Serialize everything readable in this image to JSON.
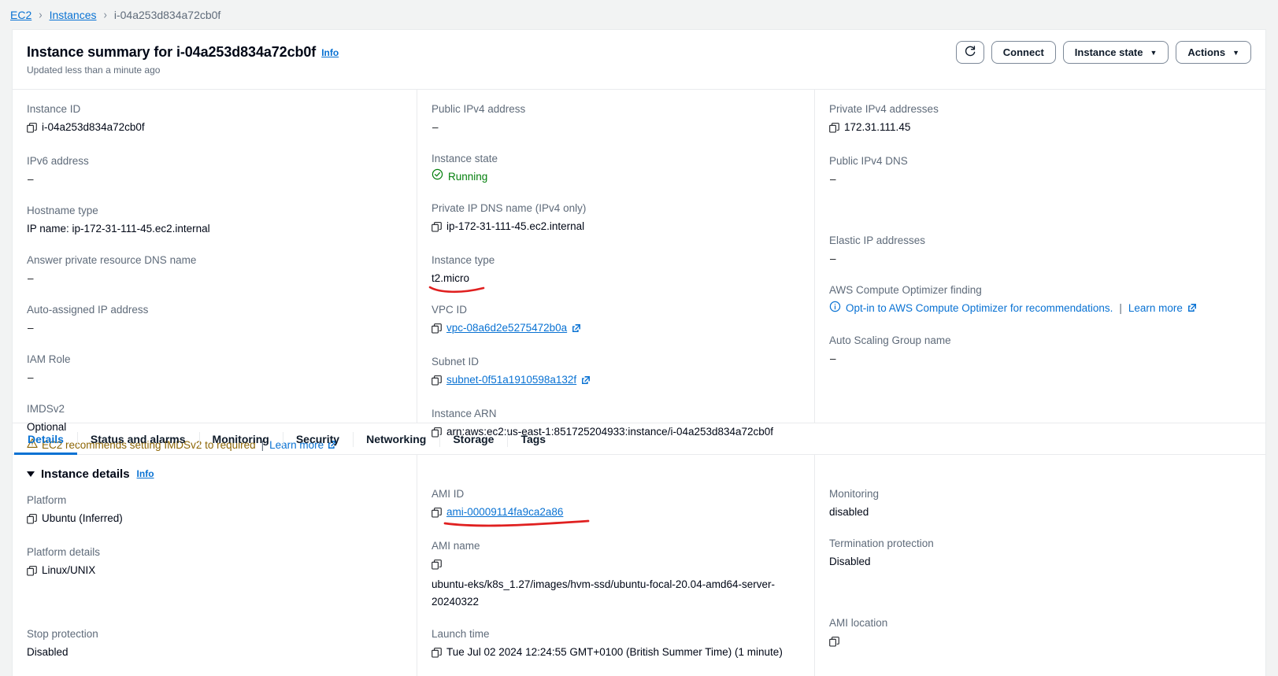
{
  "breadcrumb": {
    "items": [
      {
        "label": "EC2",
        "link": true
      },
      {
        "label": "Instances",
        "link": true
      },
      {
        "label": "i-04a253d834a72cb0f",
        "link": false
      }
    ],
    "separator": "›"
  },
  "header": {
    "title": "Instance summary for i-04a253d834a72cb0f",
    "info_label": "Info",
    "updated_text": "Updated less than a minute ago",
    "buttons": {
      "refresh_icon": "refresh-icon",
      "connect": "Connect",
      "instance_state": "Instance state",
      "actions": "Actions",
      "caret": "▼"
    }
  },
  "summary": {
    "col1": [
      {
        "label": "Instance ID",
        "value": "i-04a253d834a72cb0f",
        "copy": true
      },
      {
        "label": "IPv6 address",
        "value": "–",
        "copy": false
      },
      {
        "label": "Hostname type",
        "value": "IP name: ip-172-31-111-45.ec2.internal",
        "copy": false
      },
      {
        "label": "Answer private resource DNS name",
        "value": "–",
        "copy": false
      },
      {
        "label": "Auto-assigned IP address",
        "value": "–",
        "copy": false
      },
      {
        "label": "IAM Role",
        "value": "–",
        "copy": false
      },
      {
        "label": "IMDSv2",
        "value": "Optional",
        "copy": false
      }
    ],
    "imds_warning": {
      "icon": "warning-triangle-icon",
      "text": "EC2 recommends setting IMDSv2 to required",
      "separator": "|",
      "link": "Learn more"
    },
    "col2": [
      {
        "label": "Public IPv4 address",
        "value": "–",
        "copy": false
      },
      {
        "label": "Instance state",
        "value": "Running",
        "copy": false,
        "status": true
      },
      {
        "label": "Private IP DNS name (IPv4 only)",
        "value": "ip-172-31-111-45.ec2.internal",
        "copy": true
      },
      {
        "label": "Instance type",
        "value": "t2.micro",
        "copy": false,
        "annotated": true
      },
      {
        "label": "VPC ID",
        "value": "vpc-08a6d2e5275472b0a",
        "copy": true,
        "link": true,
        "external": true
      },
      {
        "label": "Subnet ID",
        "value": "subnet-0f51a1910598a132f",
        "copy": true,
        "link": true,
        "external": true
      },
      {
        "label": "Instance ARN",
        "value": "arn:aws:ec2:us-east-1:851725204933:instance/i-04a253d834a72cb0f",
        "copy": true
      }
    ],
    "col3": [
      {
        "label": "Private IPv4 addresses",
        "value": "172.31.111.45",
        "copy": true
      },
      {
        "label": "Public IPv4 DNS",
        "value": "–",
        "copy": false
      },
      {
        "label": "Elastic IP addresses",
        "value": "–",
        "copy": false
      }
    ],
    "optimizer": {
      "label": "AWS Compute Optimizer finding",
      "icon": "info-circle-icon",
      "link_text": "Opt-in to AWS Compute Optimizer for recommendations.",
      "separator": "|",
      "learn_more": "Learn more"
    },
    "asg": {
      "label": "Auto Scaling Group name",
      "value": "–"
    }
  },
  "tabs": [
    {
      "label": "Details",
      "active": true
    },
    {
      "label": "Status and alarms",
      "active": false
    },
    {
      "label": "Monitoring",
      "active": false
    },
    {
      "label": "Security",
      "active": false
    },
    {
      "label": "Networking",
      "active": false
    },
    {
      "label": "Storage",
      "active": false
    },
    {
      "label": "Tags",
      "active": false
    }
  ],
  "details": {
    "section_title": "Instance details",
    "info_label": "Info",
    "col1": [
      {
        "label": "Platform",
        "value": "Ubuntu (Inferred)",
        "copy": true
      },
      {
        "label": "Platform details",
        "value": "Linux/UNIX",
        "copy": true
      },
      {
        "label": "Stop protection",
        "value": "Disabled",
        "copy": false
      }
    ],
    "col2": [
      {
        "label": "AMI ID",
        "value": "ami-00009114fa9ca2a86",
        "copy": true,
        "link": true,
        "annotated": true
      },
      {
        "label": "AMI name",
        "value": "ubuntu-eks/k8s_1.27/images/hvm-ssd/ubuntu-focal-20.04-amd64-server-20240322",
        "copy": true,
        "wrap": true
      },
      {
        "label": "Launch time",
        "value": "Tue Jul 02 2024 12:24:55 GMT+0100 (British Summer Time) (1 minute)",
        "copy": true
      }
    ],
    "col3": [
      {
        "label": "Monitoring",
        "value": "disabled",
        "copy": false
      },
      {
        "label": "Termination protection",
        "value": "Disabled",
        "copy": false
      },
      {
        "label": "AMI location",
        "value": "",
        "copy": true
      }
    ]
  },
  "colors": {
    "link": "#0972d3",
    "warning": "#8d6605",
    "success": "#037f0c",
    "label": "#5f6b7a",
    "annotation": "#e02020"
  }
}
